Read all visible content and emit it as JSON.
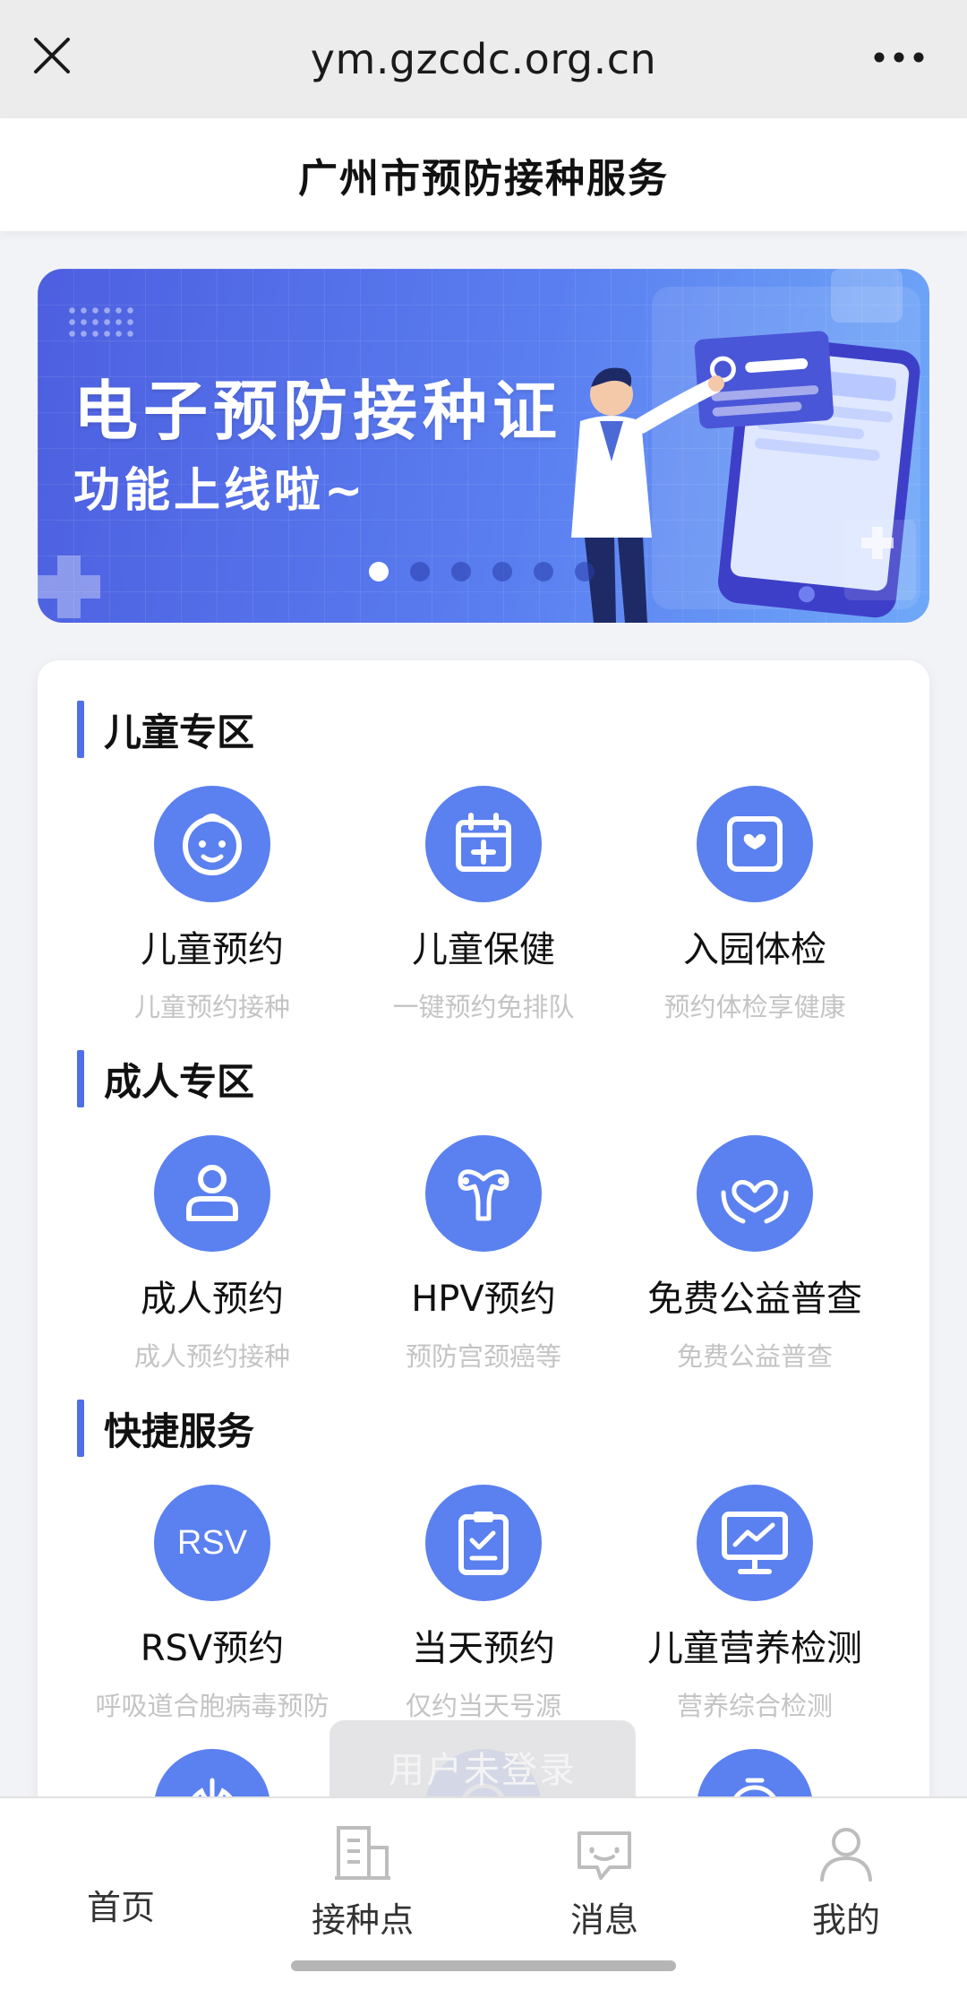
{
  "browser": {
    "url": "ym.gzcdc.org.cn",
    "close_icon": "close-icon",
    "more_icon": "more-icon"
  },
  "header": {
    "title": "广州市预防接种服务"
  },
  "banner": {
    "title": "电子预防接种证",
    "subtitle": "功能上线啦~",
    "slide_count": 6,
    "active_slide": 0
  },
  "sections": {
    "children": {
      "title": "儿童专区",
      "items": [
        {
          "label": "儿童预约",
          "sub": "儿童预约接种",
          "icon": "baby-face-icon"
        },
        {
          "label": "儿童保健",
          "sub": "一键预约免排队",
          "icon": "calendar-plus-icon"
        },
        {
          "label": "入园体检",
          "sub": "预约体检享健康",
          "icon": "heart-card-icon"
        }
      ]
    },
    "adult": {
      "title": "成人专区",
      "items": [
        {
          "label": "成人预约",
          "sub": "成人预约接种",
          "icon": "person-icon"
        },
        {
          "label": "HPV预约",
          "sub": "预防宫颈癌等",
          "icon": "uterus-icon"
        },
        {
          "label": "免费公益普查",
          "sub": "免费公益普查",
          "icon": "heart-hands-icon"
        }
      ]
    },
    "quick": {
      "title": "快捷服务",
      "items": [
        {
          "label": "RSV预约",
          "sub": "呼吸道合胞病毒预防",
          "icon": "rsv-icon",
          "icon_text": "RSV"
        },
        {
          "label": "当天预约",
          "sub": "仅约当天号源",
          "icon": "checklist-icon"
        },
        {
          "label": "儿童营养检测",
          "sub": "营养综合检测",
          "icon": "monitor-chart-icon"
        }
      ]
    }
  },
  "overlay": {
    "login_label": "用户未登录"
  },
  "nav": {
    "items": [
      {
        "label": "首页",
        "icon": ""
      },
      {
        "label": "接种点",
        "icon": "building-icon"
      },
      {
        "label": "消息",
        "icon": "message-icon"
      },
      {
        "label": "我的",
        "icon": "user-icon"
      }
    ]
  },
  "colors": {
    "accent": "#5b80f0",
    "section_bar": "#4f6ee8",
    "banner_start": "#4d5fe0",
    "banner_end": "#6fa8f8"
  }
}
